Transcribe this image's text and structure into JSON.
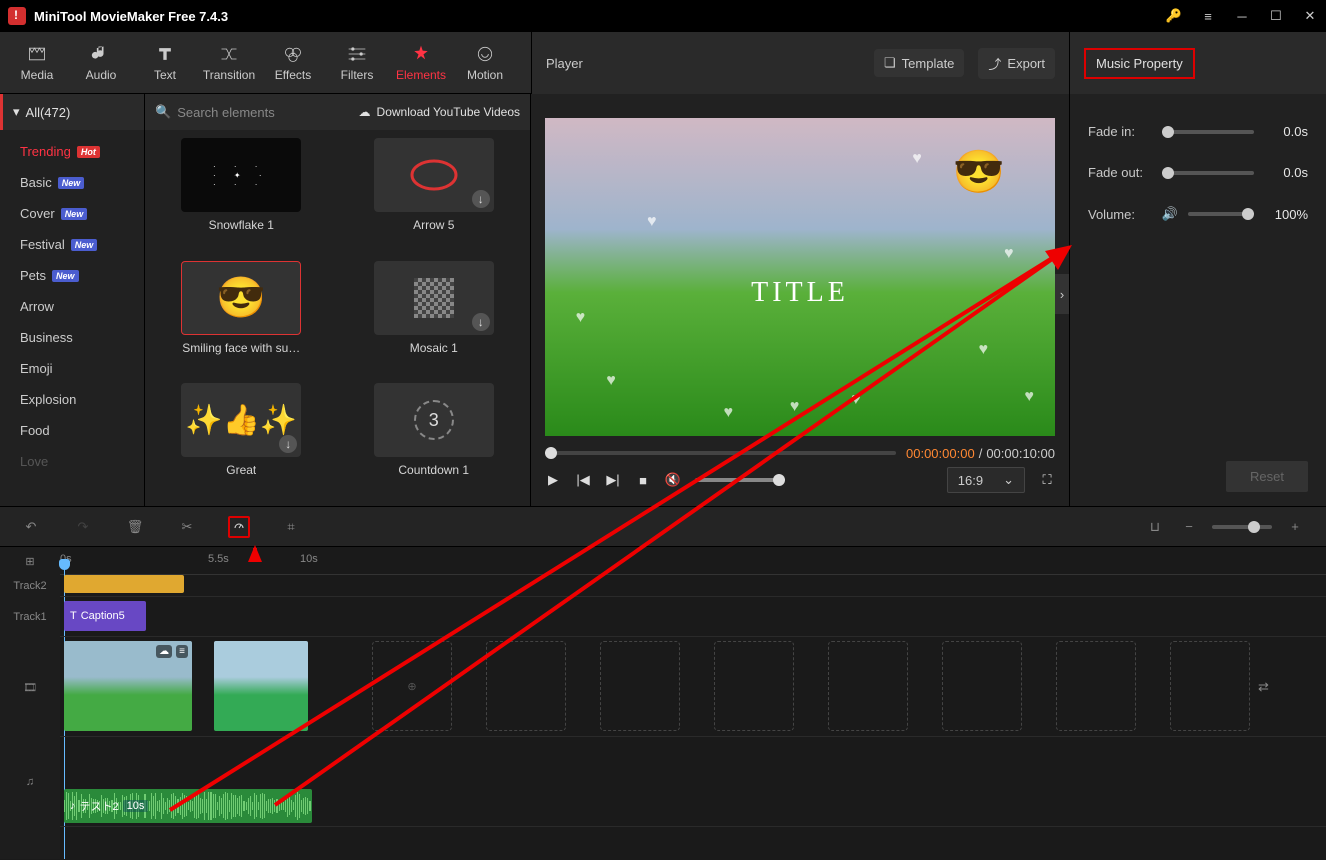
{
  "app": {
    "title": "MiniTool MovieMaker Free 7.4.3"
  },
  "tools": [
    {
      "id": "media",
      "label": "Media"
    },
    {
      "id": "audio",
      "label": "Audio"
    },
    {
      "id": "text",
      "label": "Text"
    },
    {
      "id": "transition",
      "label": "Transition"
    },
    {
      "id": "effects",
      "label": "Effects"
    },
    {
      "id": "filters",
      "label": "Filters"
    },
    {
      "id": "elements",
      "label": "Elements",
      "active": true
    },
    {
      "id": "motion",
      "label": "Motion"
    }
  ],
  "player_header": {
    "title": "Player",
    "template": "Template",
    "export": "Export"
  },
  "prop_header": "Music Property",
  "sidebar": {
    "all": "All(472)",
    "items": [
      {
        "label": "Trending",
        "badge": "Hot",
        "active": true
      },
      {
        "label": "Basic",
        "badge": "New"
      },
      {
        "label": "Cover",
        "badge": "New"
      },
      {
        "label": "Festival",
        "badge": "New"
      },
      {
        "label": "Pets",
        "badge": "New"
      },
      {
        "label": "Arrow"
      },
      {
        "label": "Business"
      },
      {
        "label": "Emoji"
      },
      {
        "label": "Explosion"
      },
      {
        "label": "Food"
      },
      {
        "label": "Love"
      }
    ]
  },
  "search_placeholder": "Search elements",
  "download_link": "Download YouTube Videos",
  "elements": [
    {
      "label": "Snowflake 1",
      "dl": false
    },
    {
      "label": "Arrow 5",
      "dl": true
    },
    {
      "label": "Smiling face with su…",
      "dl": false,
      "selected": true
    },
    {
      "label": "Mosaic 1",
      "dl": true
    },
    {
      "label": "Great",
      "dl": true
    },
    {
      "label": "Countdown 1",
      "dl": false
    }
  ],
  "preview": {
    "title_text": "TITLE",
    "time_current": "00:00:00:00",
    "time_total": "00:00:10:00",
    "aspect": "16:9"
  },
  "props": {
    "fade_in_label": "Fade in:",
    "fade_in_val": "0.0s",
    "fade_out_label": "Fade out:",
    "fade_out_val": "0.0s",
    "volume_label": "Volume:",
    "volume_val": "100%",
    "reset": "Reset"
  },
  "ruler": [
    {
      "pos": 0,
      "label": "0s"
    },
    {
      "pos": 148,
      "label": "5.5s"
    },
    {
      "pos": 240,
      "label": "10s"
    }
  ],
  "tracks": {
    "track2": "Track2",
    "track1": "Track1",
    "caption": "Caption5",
    "audio_name": "テスト2",
    "audio_time": "10s"
  }
}
